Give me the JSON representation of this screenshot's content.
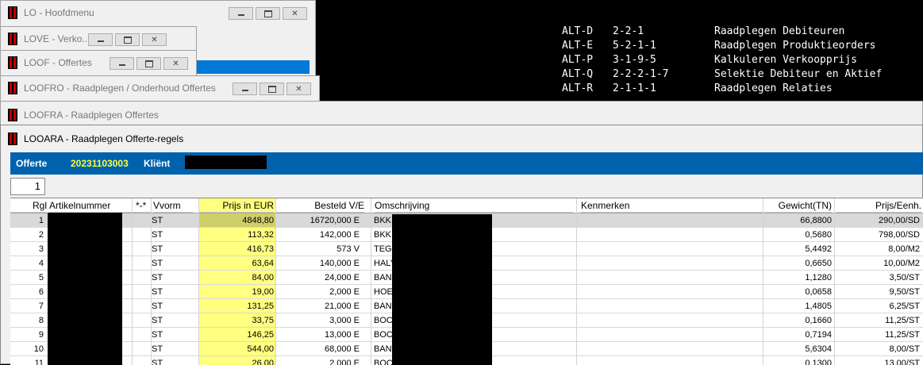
{
  "shortcuts": [
    {
      "key": "ALT-D",
      "code": "2-2-1",
      "desc": "Raadplegen Debiteuren"
    },
    {
      "key": "ALT-E",
      "code": "5-2-1-1",
      "desc": "Raadplegen Produktieorders"
    },
    {
      "key": "ALT-P",
      "code": "3-1-9-5",
      "desc": "Kalkuleren Verkoopprijs"
    },
    {
      "key": "ALT-Q",
      "code": "2-2-2-1-7",
      "desc": "Selektie Debiteur en Aktief"
    },
    {
      "key": "ALT-R",
      "code": "2-1-1-1",
      "desc": "Raadplegen Relaties"
    }
  ],
  "windows": {
    "lo": "LO - Hoofdmenu",
    "love": "LOVE - Verko...",
    "loof": "LOOF - Offertes",
    "loofro": "LOOFRO - Raadplegen / Onderhoud Offertes",
    "loofra": "LOOFRA - Raadplegen Offertes",
    "looara": "LOOARA - Raadplegen Offerte-regels"
  },
  "header": {
    "offerte_label": "Offerte",
    "offerte_value": "20231103003",
    "klient_label": "Kliënt"
  },
  "page_number": "1",
  "columns": {
    "rgl": "Rgl",
    "artikel": "Artikelnummer",
    "flag": "*-*",
    "vvorm": "Vvorm",
    "prijs": "Prijs in EUR",
    "besteld": "Besteld V/E",
    "omschrijving": "Omschrijving",
    "kenmerken": "Kenmerken",
    "gewicht": "Gewicht(TN)",
    "prijs_eenh": "Prijs/Eenh."
  },
  "rows": [
    {
      "rgl": "1",
      "vvorm": "ST",
      "prijs": "4848,80",
      "besteld": "16720,000 E",
      "omschr": "BKK",
      "gewicht": "66,8800",
      "prijs_eenh": "290,00/SD"
    },
    {
      "rgl": "2",
      "vvorm": "ST",
      "prijs": "113,32",
      "besteld": "142,000 E",
      "omschr": "BKK.",
      "gewicht": "0,5680",
      "prijs_eenh": "798,00/SD"
    },
    {
      "rgl": "3",
      "vvorm": "ST",
      "prijs": "416,73",
      "besteld": "573 V",
      "omschr": "TEG",
      "gewicht": "5,4492",
      "prijs_eenh": "8,00/M2"
    },
    {
      "rgl": "4",
      "vvorm": "ST",
      "prijs": "63,64",
      "besteld": "140,000 E",
      "omschr": "HALY",
      "gewicht": "0,6650",
      "prijs_eenh": "10,00/M2"
    },
    {
      "rgl": "5",
      "vvorm": "ST",
      "prijs": "84,00",
      "besteld": "24,000 E",
      "omschr": "BAN",
      "gewicht": "1,1280",
      "prijs_eenh": "3,50/ST"
    },
    {
      "rgl": "6",
      "vvorm": "ST",
      "prijs": "19,00",
      "besteld": "2,000 E",
      "omschr": "HOE",
      "gewicht": "0,0658",
      "prijs_eenh": "9,50/ST"
    },
    {
      "rgl": "7",
      "vvorm": "ST",
      "prijs": "131,25",
      "besteld": "21,000 E",
      "omschr": "BAN",
      "gewicht": "1,4805",
      "prijs_eenh": "6,25/ST"
    },
    {
      "rgl": "8",
      "vvorm": "ST",
      "prijs": "33,75",
      "besteld": "3,000 E",
      "omschr": "BOC",
      "gewicht": "0,1660",
      "prijs_eenh": "11,25/ST"
    },
    {
      "rgl": "9",
      "vvorm": "ST",
      "prijs": "146,25",
      "besteld": "13,000 E",
      "omschr": "BOC",
      "gewicht": "0,7194",
      "prijs_eenh": "11,25/ST"
    },
    {
      "rgl": "10",
      "vvorm": "ST",
      "prijs": "544,00",
      "besteld": "68,000 E",
      "omschr": "BAN",
      "gewicht": "5,6304",
      "prijs_eenh": "8,00/ST"
    },
    {
      "rgl": "11",
      "vvorm": "ST",
      "prijs": "26,00",
      "besteld": "2,000 E",
      "omschr": "BOC",
      "gewicht": "0,1300",
      "prijs_eenh": "13,00/ST"
    }
  ]
}
